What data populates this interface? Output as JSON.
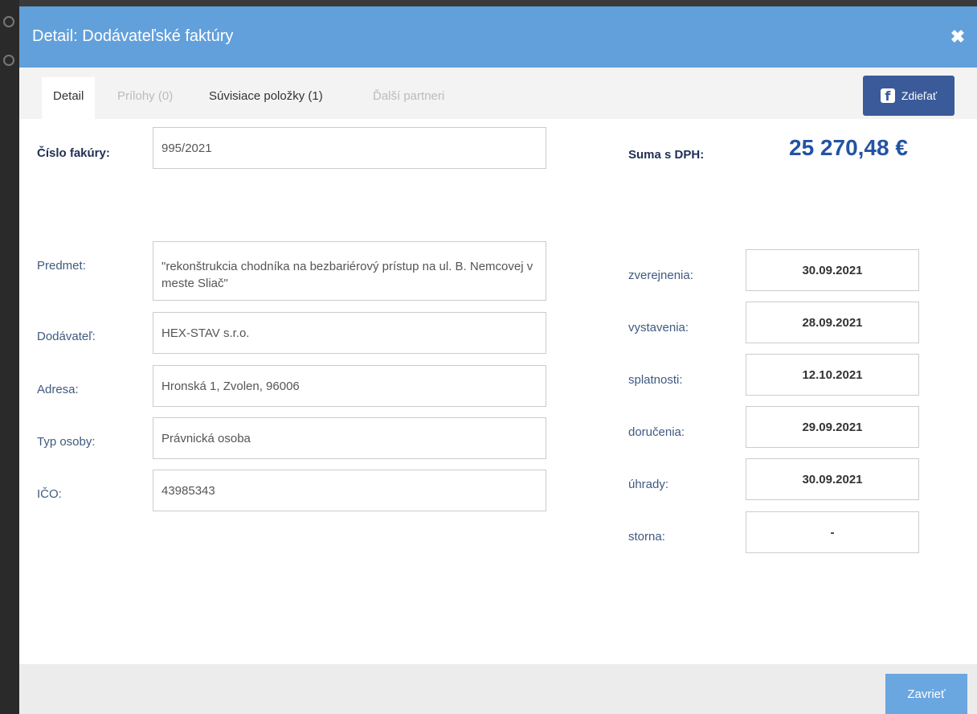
{
  "modal": {
    "title": "Detail: Dodávateľské faktúry",
    "close_glyph": "✖"
  },
  "tabs": [
    {
      "label": "Detail",
      "state": "active"
    },
    {
      "label": "Prílohy (0)",
      "state": "disabled"
    },
    {
      "label": "Súvisiace položky (1)",
      "state": "normal"
    },
    {
      "label": "Ďalší partneri",
      "state": "disabled"
    }
  ],
  "share_button": {
    "label": "Zdieľať",
    "icon": "facebook-icon",
    "icon_glyph": "f",
    "color": "#3b5a9a"
  },
  "invoice": {
    "number_label": "Číslo fakúry:",
    "number_value": "995/2021",
    "sum_label": "Suma s DPH:",
    "sum_value": "25 270,48 €",
    "subject_label": "Predmet:",
    "subject_value": "\"rekonštrukcia chodníka na bezbariérový prístup na ul. B. Nemcovej v meste Sliač\"",
    "supplier_label": "Dodávateľ:",
    "supplier_value": "HEX-STAV s.r.o.",
    "address_label": "Adresa:",
    "address_value": "Hronská 1, Zvolen, 96006",
    "person_type_label": "Typ osoby:",
    "person_type_value": "Právnická osoba",
    "ico_label": "IČO:",
    "ico_value": "43985343"
  },
  "dates": [
    {
      "label": "zverejnenia:",
      "value": "30.09.2021"
    },
    {
      "label": "vystavenia:",
      "value": "28.09.2021"
    },
    {
      "label": "splatnosti:",
      "value": "12.10.2021"
    },
    {
      "label": "doručenia:",
      "value": "29.09.2021"
    },
    {
      "label": "úhrady:",
      "value": "30.09.2021"
    },
    {
      "label": "storna:",
      "value": "-"
    }
  ],
  "footer": {
    "close_label": "Zavrieť"
  },
  "colors": {
    "header": "#62a0db",
    "sum": "#2353a3",
    "footer_button": "#6aa7e0"
  }
}
